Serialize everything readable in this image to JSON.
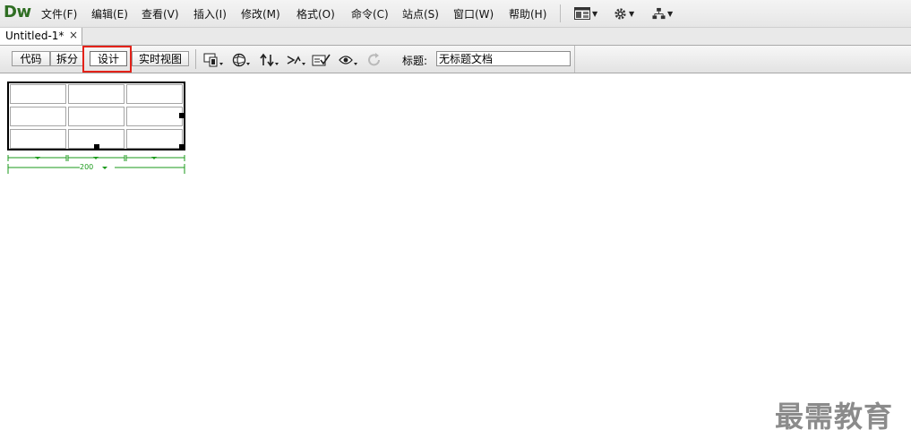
{
  "app": {
    "logo": "Dw"
  },
  "menu": {
    "items": [
      {
        "label": "文件(F)"
      },
      {
        "label": "编辑(E)"
      },
      {
        "label": "查看(V)"
      },
      {
        "label": "插入(I)"
      },
      {
        "label": "修改(M)"
      },
      {
        "label": "格式(O)"
      },
      {
        "label": "命令(C)"
      },
      {
        "label": "站点(S)"
      },
      {
        "label": "窗口(W)"
      },
      {
        "label": "帮助(H)"
      }
    ],
    "icons": [
      "layout-icon",
      "gear-icon",
      "site-icon"
    ]
  },
  "document": {
    "tab_label": "Untitled-1*",
    "close_glyph": "×"
  },
  "doc_toolbar": {
    "views": [
      {
        "label": "代码"
      },
      {
        "label": "拆分"
      },
      {
        "label": "设计",
        "active": true
      },
      {
        "label": "实时视图"
      }
    ],
    "title_label": "标题:",
    "title_value": "无标题文档",
    "highlight_color": "#e32219"
  },
  "table": {
    "rows": 3,
    "cols": 3,
    "column_width_label": "200",
    "width_indicator_color": "#1a9a1a"
  },
  "watermark": "最需教育"
}
